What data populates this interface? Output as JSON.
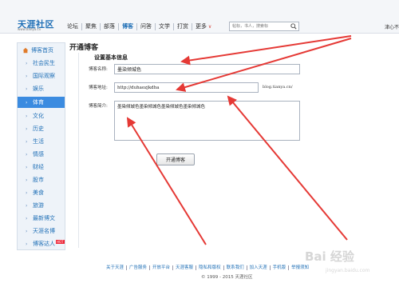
{
  "header": {
    "logo_text": "天涯社区",
    "logo_subtext": "www.tianya.cn",
    "nav": [
      "论坛",
      "聚焦",
      "部落",
      "博客",
      "问答",
      "文学",
      "打赏"
    ],
    "nav_active": "博客",
    "more_label": "更多",
    "search_placeholder": "帖标，书人，搜索标",
    "username": "津心不"
  },
  "sidebar": {
    "home_label": "博客首页",
    "items": [
      "社会民生",
      "国际观察",
      "娱乐",
      "体育",
      "文化",
      "历史",
      "生活",
      "情感",
      "财经",
      "股市",
      "美食",
      "旅游",
      "最新博文",
      "天涯名博",
      "博客达人"
    ],
    "active": "体育",
    "hot_badge": "HOT"
  },
  "main": {
    "page_title": "开通博客",
    "section_title": "设置基本信息",
    "blog_name_label": "博客名称:",
    "blog_name_value": "墨染倾城色",
    "blog_address_label": "博客地址:",
    "blog_address_value": "http://duhaozjkdha",
    "blog_address_suffix": "blog.tianya.cn/",
    "blog_intro_label": "博客简介:",
    "blog_intro_value": "墨染倾城色墨染倾城色墨染倾城色墨染倾城色",
    "submit_label": "开通博客"
  },
  "footer": {
    "links": [
      "关于天涯",
      "广告服务",
      "开放平台",
      "天涯客服",
      "隐私和版权",
      "联系我们",
      "加入天涯",
      "手机版",
      "举报须知"
    ],
    "copyright": "© 1999 - 2015 天涯社区"
  },
  "watermark": {
    "text": "Bai 经验",
    "subtext": "jingyan.baidu.com"
  },
  "colors": {
    "accent": "#1f6fb6",
    "active_bg": "#3b8be0",
    "annotation": "#e53935"
  }
}
